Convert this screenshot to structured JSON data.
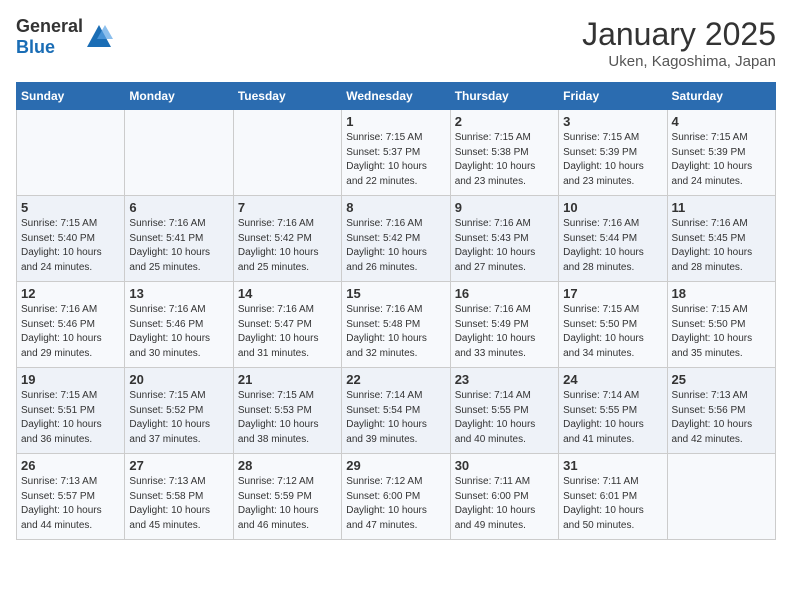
{
  "header": {
    "logo_general": "General",
    "logo_blue": "Blue",
    "title": "January 2025",
    "location": "Uken, Kagoshima, Japan"
  },
  "days_of_week": [
    "Sunday",
    "Monday",
    "Tuesday",
    "Wednesday",
    "Thursday",
    "Friday",
    "Saturday"
  ],
  "weeks": [
    [
      {
        "day": "",
        "detail": ""
      },
      {
        "day": "",
        "detail": ""
      },
      {
        "day": "",
        "detail": ""
      },
      {
        "day": "1",
        "detail": "Sunrise: 7:15 AM\nSunset: 5:37 PM\nDaylight: 10 hours\nand 22 minutes."
      },
      {
        "day": "2",
        "detail": "Sunrise: 7:15 AM\nSunset: 5:38 PM\nDaylight: 10 hours\nand 23 minutes."
      },
      {
        "day": "3",
        "detail": "Sunrise: 7:15 AM\nSunset: 5:39 PM\nDaylight: 10 hours\nand 23 minutes."
      },
      {
        "day": "4",
        "detail": "Sunrise: 7:15 AM\nSunset: 5:39 PM\nDaylight: 10 hours\nand 24 minutes."
      }
    ],
    [
      {
        "day": "5",
        "detail": "Sunrise: 7:15 AM\nSunset: 5:40 PM\nDaylight: 10 hours\nand 24 minutes."
      },
      {
        "day": "6",
        "detail": "Sunrise: 7:16 AM\nSunset: 5:41 PM\nDaylight: 10 hours\nand 25 minutes."
      },
      {
        "day": "7",
        "detail": "Sunrise: 7:16 AM\nSunset: 5:42 PM\nDaylight: 10 hours\nand 25 minutes."
      },
      {
        "day": "8",
        "detail": "Sunrise: 7:16 AM\nSunset: 5:42 PM\nDaylight: 10 hours\nand 26 minutes."
      },
      {
        "day": "9",
        "detail": "Sunrise: 7:16 AM\nSunset: 5:43 PM\nDaylight: 10 hours\nand 27 minutes."
      },
      {
        "day": "10",
        "detail": "Sunrise: 7:16 AM\nSunset: 5:44 PM\nDaylight: 10 hours\nand 28 minutes."
      },
      {
        "day": "11",
        "detail": "Sunrise: 7:16 AM\nSunset: 5:45 PM\nDaylight: 10 hours\nand 28 minutes."
      }
    ],
    [
      {
        "day": "12",
        "detail": "Sunrise: 7:16 AM\nSunset: 5:46 PM\nDaylight: 10 hours\nand 29 minutes."
      },
      {
        "day": "13",
        "detail": "Sunrise: 7:16 AM\nSunset: 5:46 PM\nDaylight: 10 hours\nand 30 minutes."
      },
      {
        "day": "14",
        "detail": "Sunrise: 7:16 AM\nSunset: 5:47 PM\nDaylight: 10 hours\nand 31 minutes."
      },
      {
        "day": "15",
        "detail": "Sunrise: 7:16 AM\nSunset: 5:48 PM\nDaylight: 10 hours\nand 32 minutes."
      },
      {
        "day": "16",
        "detail": "Sunrise: 7:16 AM\nSunset: 5:49 PM\nDaylight: 10 hours\nand 33 minutes."
      },
      {
        "day": "17",
        "detail": "Sunrise: 7:15 AM\nSunset: 5:50 PM\nDaylight: 10 hours\nand 34 minutes."
      },
      {
        "day": "18",
        "detail": "Sunrise: 7:15 AM\nSunset: 5:50 PM\nDaylight: 10 hours\nand 35 minutes."
      }
    ],
    [
      {
        "day": "19",
        "detail": "Sunrise: 7:15 AM\nSunset: 5:51 PM\nDaylight: 10 hours\nand 36 minutes."
      },
      {
        "day": "20",
        "detail": "Sunrise: 7:15 AM\nSunset: 5:52 PM\nDaylight: 10 hours\nand 37 minutes."
      },
      {
        "day": "21",
        "detail": "Sunrise: 7:15 AM\nSunset: 5:53 PM\nDaylight: 10 hours\nand 38 minutes."
      },
      {
        "day": "22",
        "detail": "Sunrise: 7:14 AM\nSunset: 5:54 PM\nDaylight: 10 hours\nand 39 minutes."
      },
      {
        "day": "23",
        "detail": "Sunrise: 7:14 AM\nSunset: 5:55 PM\nDaylight: 10 hours\nand 40 minutes."
      },
      {
        "day": "24",
        "detail": "Sunrise: 7:14 AM\nSunset: 5:55 PM\nDaylight: 10 hours\nand 41 minutes."
      },
      {
        "day": "25",
        "detail": "Sunrise: 7:13 AM\nSunset: 5:56 PM\nDaylight: 10 hours\nand 42 minutes."
      }
    ],
    [
      {
        "day": "26",
        "detail": "Sunrise: 7:13 AM\nSunset: 5:57 PM\nDaylight: 10 hours\nand 44 minutes."
      },
      {
        "day": "27",
        "detail": "Sunrise: 7:13 AM\nSunset: 5:58 PM\nDaylight: 10 hours\nand 45 minutes."
      },
      {
        "day": "28",
        "detail": "Sunrise: 7:12 AM\nSunset: 5:59 PM\nDaylight: 10 hours\nand 46 minutes."
      },
      {
        "day": "29",
        "detail": "Sunrise: 7:12 AM\nSunset: 6:00 PM\nDaylight: 10 hours\nand 47 minutes."
      },
      {
        "day": "30",
        "detail": "Sunrise: 7:11 AM\nSunset: 6:00 PM\nDaylight: 10 hours\nand 49 minutes."
      },
      {
        "day": "31",
        "detail": "Sunrise: 7:11 AM\nSunset: 6:01 PM\nDaylight: 10 hours\nand 50 minutes."
      },
      {
        "day": "",
        "detail": ""
      }
    ]
  ]
}
